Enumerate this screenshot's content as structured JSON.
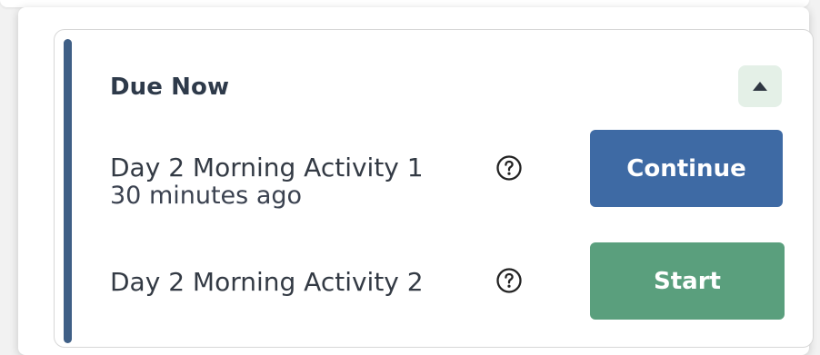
{
  "section": {
    "title": "Due Now",
    "collapse_icon": "caret-up-icon"
  },
  "activities": [
    {
      "name": "Day 2 Morning Activity 1",
      "time": "30 minutes ago",
      "help_icon": "question-circle-icon",
      "action_label": "Continue",
      "action_color": "#3e6aa4"
    },
    {
      "name": "Day 2 Morning Activity 2",
      "help_icon": "question-circle-icon",
      "action_label": "Start",
      "action_color": "#5a9f7d"
    }
  ],
  "colors": {
    "accent_bar": "#3f5f86",
    "toggle_bg": "#e4f0e7",
    "title_text": "#2e3a4a"
  }
}
